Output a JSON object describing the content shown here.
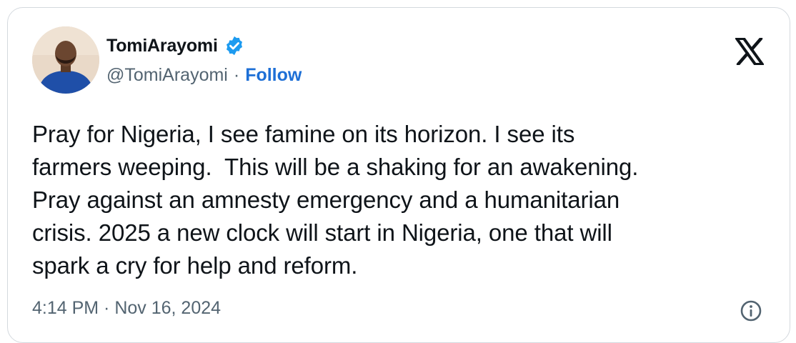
{
  "author": {
    "display_name": "TomiArayomi",
    "handle": "@TomiArayomi",
    "separator": "·",
    "follow_label": "Follow",
    "verified_icon": "verified-badge-icon",
    "avatar": "avatar"
  },
  "tweet": {
    "text": "Pray for Nigeria, I see famine on its horizon. I see its\nfarmers weeping.  This will be a shaking for an awakening.\nPray against an amnesty emergency and a humanitarian\ncrisis. 2025 a new clock will start in Nigeria, one that will\nspark a cry for help and reform.",
    "timestamp": "4:14 PM · Nov 16, 2024"
  },
  "icons": {
    "brand": "x-logo-icon",
    "info": "info-icon"
  },
  "colors": {
    "verified": "#1d9bf0",
    "follow": "#1d6fd6",
    "text": "#0f1419",
    "secondary": "#536471",
    "border": "#d4d9de"
  }
}
